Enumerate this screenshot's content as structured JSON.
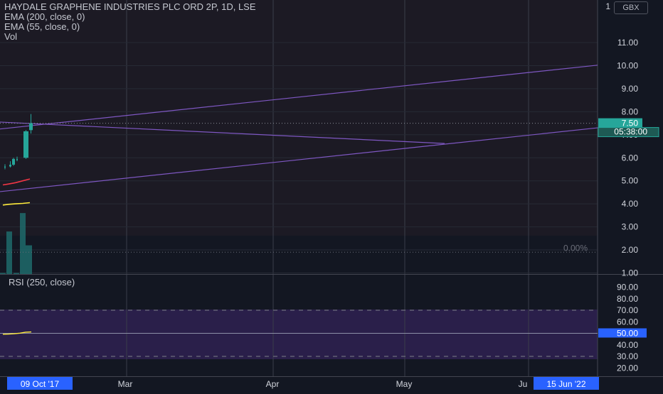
{
  "window": {
    "title": "HAYDALE GRAPHENE INDUSTRIES PLC ORD 2P, 1D, LSE"
  },
  "legend": {
    "title": "HAYDALE GRAPHENE INDUSTRIES PLC ORD 2P, 1D, LSE",
    "ema200_label": "EMA (200, close, 0)",
    "ema55_label": "EMA (55, close, 0)",
    "vol_label": "Vol"
  },
  "currency_badge": "GBX",
  "price_axis": {
    "ticks": [
      "11.00",
      "10.00",
      "9.00",
      "8.00",
      "7.00",
      "6.00",
      "5.00",
      "4.00",
      "3.00",
      "2.00",
      "1.00"
    ],
    "top_tick": "1"
  },
  "rsi_axis": {
    "ticks": [
      "90.00",
      "80.00",
      "70.00",
      "60.00",
      "50.00",
      "40.00",
      "30.00",
      "20.00"
    ]
  },
  "last_price_label": "7.50",
  "countdown_label": "05:38:00",
  "rsi_value_label": "50.00",
  "fib_label": "0.00%",
  "rsi_legend": "RSI (250, close)",
  "time_axis": {
    "labels": [
      "Mar",
      "Apr",
      "May",
      "Ju"
    ],
    "start_badge": "09 Oct '17",
    "end_badge": "15 Jun '22"
  },
  "colors": {
    "background": "#131722",
    "up_candle": "#26a69a",
    "trendline": "#7e57c2",
    "ema200": "#f23645",
    "ema55": "#ffeb3b",
    "rsi_line": "#ffeb3b",
    "rsi_band": "#2a1f4a",
    "volume": "#1f6b6b",
    "last_price_tag": "#26a69a",
    "rsi_tag": "#2962ff",
    "date_badge": "#2962ff"
  },
  "chart_data": [
    {
      "type": "candlestick",
      "title": "HAYDALE GRAPHENE INDUSTRIES PLC ORD 2P, 1D, LSE",
      "ylim": [
        0.4,
        12.4
      ],
      "y_ticks": [
        1,
        2,
        3,
        4,
        5,
        6,
        7,
        8,
        9,
        10,
        11
      ],
      "candles": [
        {
          "open": 5.6,
          "high": 5.72,
          "low": 5.5,
          "close": 5.62
        },
        {
          "open": 5.62,
          "high": 5.85,
          "low": 5.58,
          "close": 5.7
        },
        {
          "open": 5.7,
          "high": 6.0,
          "low": 5.65,
          "close": 5.95
        },
        {
          "open": 5.9,
          "high": 6.05,
          "low": 5.85,
          "close": 5.95
        },
        {
          "open": 6.0,
          "high": 7.2,
          "low": 5.95,
          "close": 7.15
        },
        {
          "open": 7.2,
          "high": 7.9,
          "low": 7.05,
          "close": 7.5
        }
      ],
      "volume": [
        0.4,
        2.2,
        0.4,
        3.0,
        1.6
      ],
      "ema200": [
        4.82,
        4.86,
        4.92,
        5.0,
        5.08
      ],
      "ema55": [
        3.95,
        3.98,
        4.0,
        4.02,
        4.05
      ],
      "last_price": 7.5,
      "fib_level": 1.9,
      "trendlines": [
        {
          "from": 7.25,
          "to": 10.02
        },
        {
          "from": 4.53,
          "to": 7.3
        },
        {
          "from": 7.55,
          "to": 6.62
        }
      ]
    },
    {
      "type": "line",
      "title": "RSI (250, close)",
      "ylim": [
        15,
        96
      ],
      "y_ticks": [
        20,
        30,
        40,
        50,
        60,
        70,
        80,
        90
      ],
      "upper_band": 70,
      "lower_band": 30,
      "middle": 50,
      "values": [
        49.2,
        49.3,
        49.6,
        50.1,
        51.0,
        51.2
      ]
    }
  ]
}
